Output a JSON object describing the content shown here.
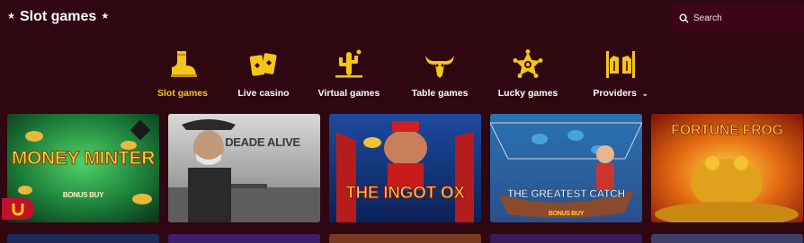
{
  "header": {
    "title": "Slot games",
    "search_label": "Search"
  },
  "categories": [
    {
      "label": "Slot games",
      "icon": "boot-icon",
      "active": true
    },
    {
      "label": "Live casino",
      "icon": "cards-icon",
      "active": false
    },
    {
      "label": "Virtual games",
      "icon": "cactus-icon",
      "active": false
    },
    {
      "label": "Table games",
      "icon": "bull-skull-icon",
      "active": false
    },
    {
      "label": "Lucky games",
      "icon": "sheriff-badge-icon",
      "active": false
    },
    {
      "label": "Providers",
      "icon": "saloon-doors-icon",
      "active": false,
      "has_dropdown": true
    }
  ],
  "games": [
    {
      "title": "MONEY MINTER",
      "subtitle": "BONUS BUY"
    },
    {
      "title": "DEADE ALIVE",
      "subtitle": ""
    },
    {
      "title": "THE INGOT OX",
      "subtitle": ""
    },
    {
      "title": "THE GREATEST CATCH",
      "subtitle": "BONUS BUY"
    },
    {
      "title": "FORTUNE FROG",
      "subtitle": ""
    }
  ],
  "colors": {
    "background": "#2e0711",
    "accent": "#f5c518",
    "search_bg": "#3c0616"
  }
}
